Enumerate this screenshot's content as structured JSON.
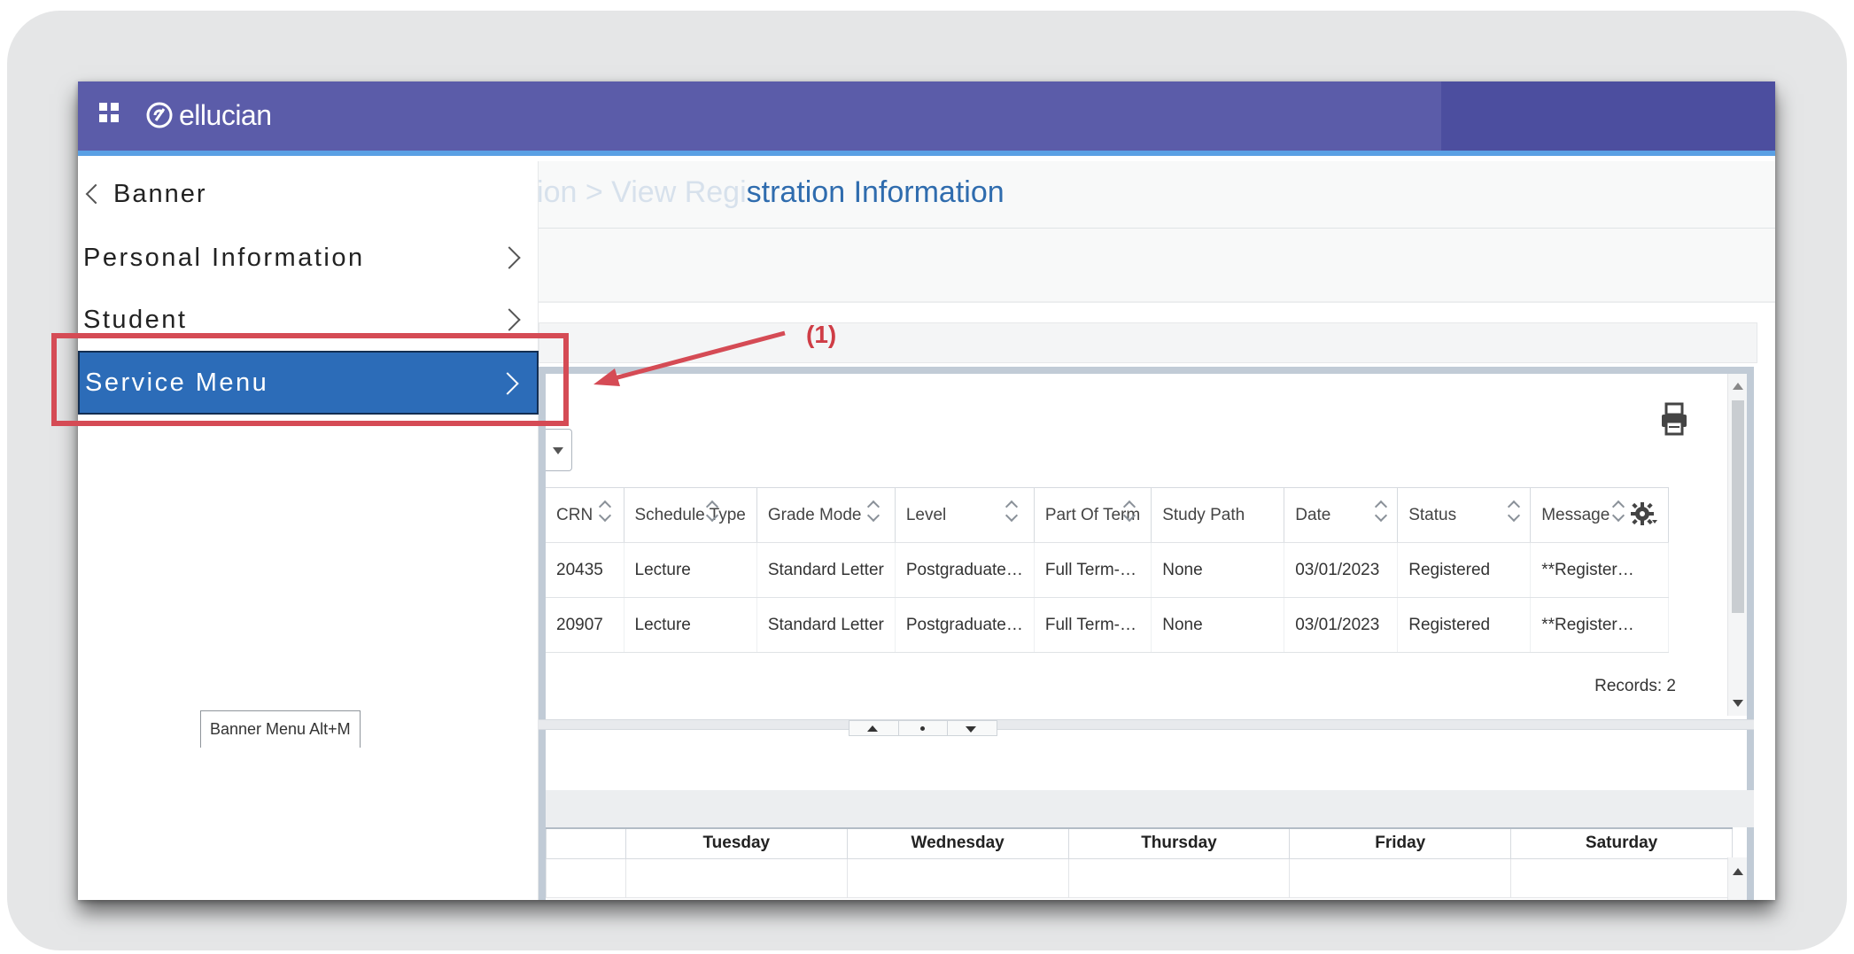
{
  "header": {
    "brand": "ellucian",
    "apps_icon": "grid-icon",
    "logo_icon": "ellucian-logo-icon"
  },
  "breadcrumb": {
    "title_faded": "Registration  >  View Regi",
    "title_visible": "stration Information"
  },
  "sidebar": {
    "back_label": "Banner",
    "items": [
      {
        "label": "Personal Information",
        "active": false
      },
      {
        "label": "Student",
        "active": false
      },
      {
        "label": "Service Menu",
        "active": true
      }
    ],
    "tooltip": "Banner Menu Alt+M"
  },
  "grid": {
    "columns": [
      "CRN",
      "Schedule Type",
      "Grade Mode",
      "Level",
      "Part Of Term",
      "Study Path",
      "Date",
      "Status",
      "Message"
    ],
    "rows": [
      [
        "20435",
        "Lecture",
        "Standard Letter",
        "Postgraduate…",
        "Full Term-…",
        "None",
        "03/01/2023",
        "Registered",
        "**Register…"
      ],
      [
        "20907",
        "Lecture",
        "Standard Letter",
        "Postgraduate…",
        "Full Term-…",
        "None",
        "03/01/2023",
        "Registered",
        "**Register…"
      ]
    ],
    "records": "Records: 2"
  },
  "schedule": {
    "days": [
      "Tuesday",
      "Wednesday",
      "Thursday",
      "Friday",
      "Saturday"
    ]
  },
  "annotation": {
    "label": "(1)",
    "color": "#d54b55"
  },
  "colors": {
    "topbar": "#5b5ca9",
    "accent": "#2c6cb8",
    "title": "#2f6cae"
  }
}
